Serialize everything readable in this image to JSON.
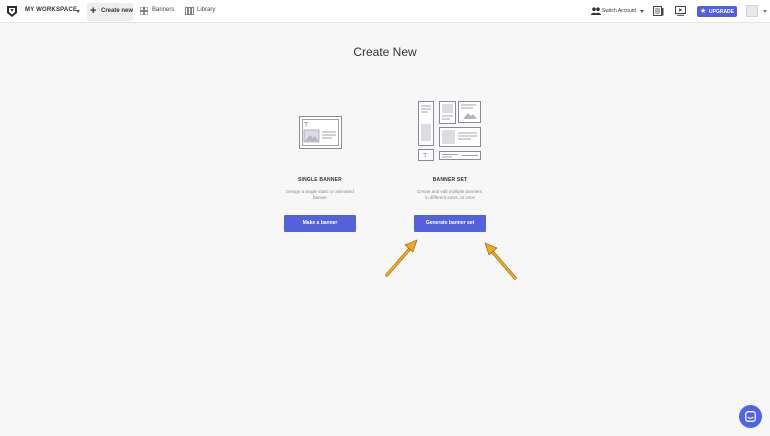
{
  "topbar": {
    "workspace_label": "MY WORKSPACE",
    "nav": {
      "create_new": "Create new",
      "banners": "Banners",
      "library": "Library"
    },
    "switch_account": "Switch Account",
    "upgrade": "UPGRADE"
  },
  "main": {
    "title": "Create New",
    "cards": [
      {
        "title": "SINGLE BANNER",
        "description": "Design a single static or animated banner",
        "button": "Make a banner"
      },
      {
        "title": "BANNER SET",
        "description": "Create and edit multiple banners, in different sizes, at once",
        "button": "Generate banner set"
      }
    ]
  },
  "colors": {
    "accent": "#5362dc",
    "arrow": "#f0a91d",
    "background": "#f7f7f8"
  },
  "icons": [
    "logo-icon",
    "plus-icon",
    "banners-icon",
    "library-icon",
    "users-icon",
    "news-icon",
    "video-icon",
    "star-icon",
    "chat-icon"
  ]
}
